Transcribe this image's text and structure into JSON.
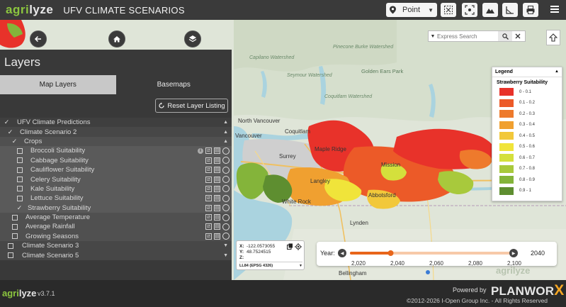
{
  "header": {
    "brand_part1": "agri",
    "brand_part2": "lyze",
    "title": "UFV CLIMATE SCENARIOS",
    "point_label": "Point"
  },
  "search": {
    "placeholder": "Express Search"
  },
  "panel": {
    "title": "Layers",
    "tabs": [
      {
        "label": "Map Layers"
      },
      {
        "label": "Basemaps"
      }
    ],
    "reset_label": "Reset Layer Listing",
    "tree": [
      {
        "label": "UFV Climate Predictions"
      },
      {
        "label": "Climate Scenario 2"
      },
      {
        "label": "Crops"
      },
      {
        "label": "Broccoli Suitability"
      },
      {
        "label": "Cabbage Suitability"
      },
      {
        "label": "Cauliflower Suitability"
      },
      {
        "label": "Celery Suitability"
      },
      {
        "label": "Kale Suitability"
      },
      {
        "label": "Lettuce Suitability"
      },
      {
        "label": "Strawberry Suitability"
      },
      {
        "label": "Average Temperature"
      },
      {
        "label": "Average Rainfall"
      },
      {
        "label": "Growing Seasons"
      },
      {
        "label": "Climate Scenario 3"
      },
      {
        "label": "Climate Scenario 5"
      }
    ]
  },
  "legend": {
    "header": "Legend",
    "title": "Strawberry Suitability",
    "classes": [
      {
        "label": "0 - 0.1",
        "color": "#e8322a"
      },
      {
        "label": "0.1 - 0.2",
        "color": "#ec5a28"
      },
      {
        "label": "0.2 - 0.3",
        "color": "#ee7a2c"
      },
      {
        "label": "0.3 - 0.4",
        "color": "#f0a030"
      },
      {
        "label": "0.4 - 0.5",
        "color": "#f2c83a"
      },
      {
        "label": "0.5 - 0.6",
        "color": "#f0e43a"
      },
      {
        "label": "0.6 - 0.7",
        "color": "#d4e03c"
      },
      {
        "label": "0.7 - 0.8",
        "color": "#a8c93c"
      },
      {
        "label": "0.8 - 0.9",
        "color": "#84b43a"
      },
      {
        "label": "0.9 - 1",
        "color": "#5e8e30"
      }
    ]
  },
  "map_labels": {
    "north_vancouver": "North Vancouver",
    "vancouver": "Vancouver",
    "coquitlam": "Coquitlam",
    "surrey": "Surrey",
    "maple_ridge": "Maple Ridge",
    "mission": "Mission",
    "langley": "Langley",
    "abbotsford": "Abbotsford",
    "white_rock": "White Rock",
    "lynden": "Lynden",
    "bellingham": "Bellingham",
    "golden_ears": "Golden Ears Park",
    "pinecone": "Pinecone Burke Watershed",
    "capilano": "Capilano Watershed",
    "seymour": "Seymour Watershed",
    "coquitlam_ws": "Coquitlam Watershed",
    "watermark": "agrilyze"
  },
  "coords": {
    "x_label": "X:",
    "x": "-122.0573055",
    "y_label": "Y:",
    "y": "48.7524515",
    "z_label": "Z:",
    "projection": "LL84 (EPSG 4326)"
  },
  "year_slider": {
    "label": "Year:",
    "value": "2040",
    "ticks": [
      "2,020",
      "2,040",
      "2,060",
      "2,080",
      "2,100"
    ],
    "fraction": 0.25
  },
  "footer": {
    "brand_part1": "agri",
    "brand_part2": "lyze",
    "version": "v3.7.1",
    "powered_by": "Powered by",
    "planworx": "PLANWOR",
    "planworx_x": "X",
    "copyright": "©2012-2026 I-Open Group Inc. - All Rights Reserved"
  },
  "colors": {
    "accent": "#e8322a",
    "brand_green": "#8cc63f",
    "planworx_orange": "#f5a623"
  }
}
